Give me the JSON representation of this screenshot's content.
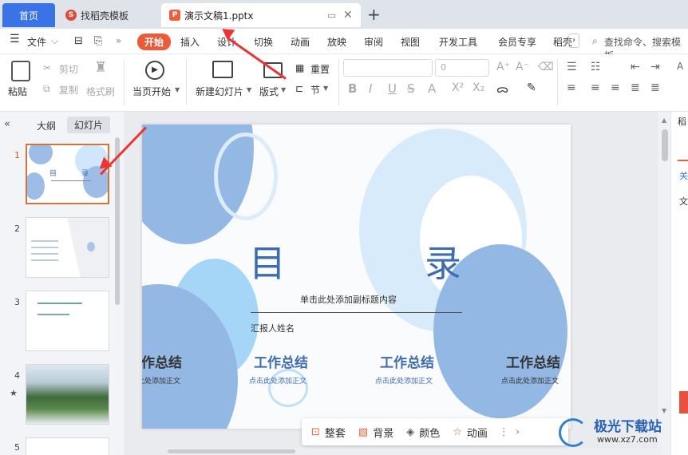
{
  "tabs": {
    "home": "首页",
    "template": "找稻壳模板",
    "doc": "演示文稿1.pptx"
  },
  "menu": {
    "file": "文件",
    "items": [
      "开始",
      "插入",
      "设计",
      "切换",
      "动画",
      "放映",
      "审阅",
      "视图",
      "开发工具",
      "会员专享",
      "稻壳"
    ],
    "search": "查找命令、搜索模板"
  },
  "ribbon": {
    "paste": "粘贴",
    "cut": "剪切",
    "copy": "复制",
    "format_painter": "格式刷",
    "start_from_current": "当页开始",
    "new_slide": "新建幻灯片",
    "layout": "版式",
    "reset": "重置",
    "section": "节",
    "font_size": "0"
  },
  "panel": {
    "outline_tab": "大纲",
    "slides_tab": "幻灯片",
    "nums": [
      "1",
      "2",
      "3",
      "4",
      "5"
    ]
  },
  "thumb1": {
    "title_a": "目",
    "title_b": "录"
  },
  "slide": {
    "title_a": "目",
    "title_b": "录",
    "subtitle": "单击此处添加副标题内容",
    "reporter": "汇报人姓名",
    "items": [
      {
        "heading": "工作总结",
        "body": "点击此处添加正文"
      },
      {
        "heading": "工作总结",
        "body": "点击此处添加正文"
      },
      {
        "heading": "工作总结",
        "body": "点击此处添加正文"
      },
      {
        "heading": "工作总结",
        "body": "点击此处添加正文"
      }
    ]
  },
  "floatbar": {
    "set": "整套",
    "background": "背景",
    "color": "颜色",
    "animation": "动画"
  },
  "right": {
    "a": "稻",
    "b": "关",
    "c": "文"
  },
  "watermark": {
    "name": "极光下载站",
    "url": "www.xz7.com"
  },
  "colors": {
    "accent_blue": "#3a73e6",
    "start_red": "#ea5b3a",
    "slide_title": "#3e6cb0"
  }
}
